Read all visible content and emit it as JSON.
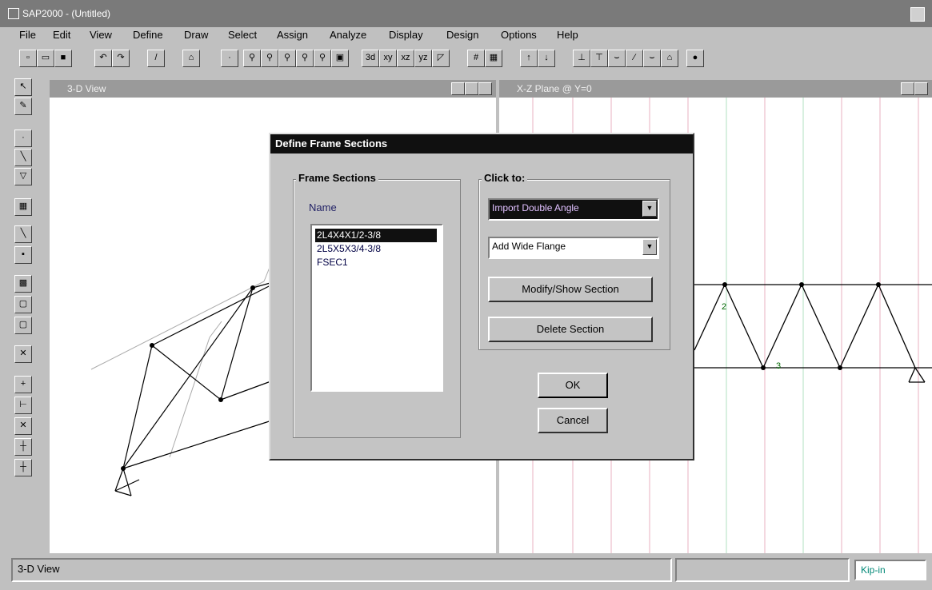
{
  "app": {
    "title": "SAP2000 - (Untitled)"
  },
  "menu": [
    "File",
    "Edit",
    "View",
    "Define",
    "Draw",
    "Select",
    "Assign",
    "Analyze",
    "Display",
    "Design",
    "Options",
    "Help"
  ],
  "windows": {
    "left_title": "3-D View",
    "right_title": "X-Z Plane @ Y=0"
  },
  "status": {
    "text": "3-D View",
    "units": "Kip-in"
  },
  "dialog": {
    "title": "Define Frame Sections",
    "sections_group": "Frame Sections",
    "name_label": "Name",
    "items": [
      "2L4X4X1/2-3/8",
      "2L5X5X3/4-3/8",
      "FSEC1"
    ],
    "selected_index": 0,
    "click_group": "Click to:",
    "import_combo": "Import Double Angle",
    "add_combo": "Add Wide Flange",
    "modify_button": "Modify/Show Section",
    "delete_button": "Delete Section",
    "ok_button": "OK",
    "cancel_button": "Cancel"
  },
  "truss_labels": {
    "joint_left": "2",
    "joint_right": "3"
  },
  "icons": {
    "toolbar": [
      "new-icon",
      "open-icon",
      "save-icon",
      "undo-icon",
      "redo-icon",
      "pencil-icon",
      "lock-icon",
      "pointer-icon",
      "zoom-window-icon",
      "zoom-in-icon",
      "zoom-out-icon",
      "zoom-prev-icon",
      "zoom-full-icon",
      "refresh-icon",
      "view-3d-icon",
      "view-xy-icon",
      "view-xz-icon",
      "view-yz-icon",
      "perspective-icon",
      "grid-icon",
      "display-icon",
      "up-icon",
      "down-icon",
      "frame-icon",
      "section-icon",
      "load-icon",
      "deform-icon",
      "moment-icon",
      "shear-icon",
      "run-icon"
    ],
    "left": [
      "select-pointer-icon",
      "rubberband-icon",
      "draw-joint-icon",
      "draw-frame-icon",
      "draw-support-icon",
      "draw-area-icon",
      "draw-line-icon",
      "add-joint-icon",
      "select-all-icon",
      "previous-icon",
      "clear-icon",
      "intersect-icon",
      "snap-joint-icon",
      "snap-midpoint-icon",
      "snap-intersection-icon",
      "snap-perpendicular-icon",
      "snap-line-icon"
    ]
  }
}
